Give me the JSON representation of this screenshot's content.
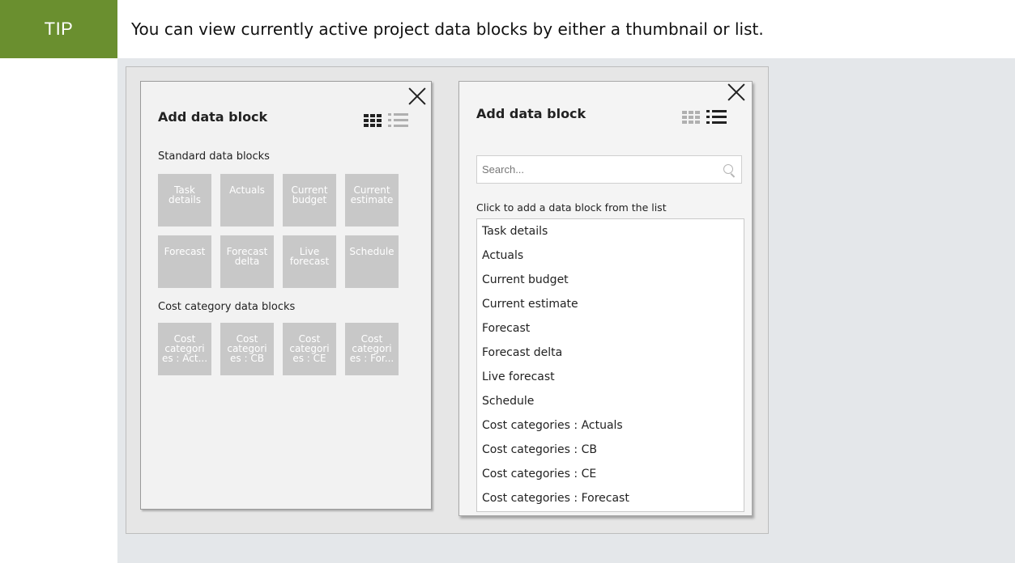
{
  "tip": {
    "badge": "TIP",
    "text": "You can view currently active project data blocks by either a thumbnail or list."
  },
  "thumbnail_panel": {
    "title": "Add data block",
    "standard_label": "Standard data blocks",
    "standard_blocks": [
      "Task\ndetails",
      "Actuals",
      "Current\nbudget",
      "Current\nestimate",
      "Forecast",
      "Forecast\ndelta",
      "Live\nforecast",
      "Schedule"
    ],
    "cost_label": "Cost category data blocks",
    "cost_blocks": [
      "Cost\ncategori\nes : Act...",
      "Cost\ncategori\nes : CB",
      "Cost\ncategori\nes : CE",
      "Cost\ncategori\nes : For..."
    ]
  },
  "list_panel": {
    "title": "Add data block",
    "search_placeholder": "Search...",
    "instructions": "Click to add a data block from the list",
    "items": [
      "Task details",
      "Actuals",
      "Current budget",
      "Current estimate",
      "Forecast",
      "Forecast delta",
      "Live forecast",
      "Schedule",
      "Cost categories : Actuals",
      "Cost categories : CB",
      "Cost categories : CE",
      "Cost categories : Forecast"
    ]
  },
  "colors": {
    "tip_badge": "#6a8f2f",
    "tile": "#c8c8c8",
    "tip_background": "#e4e7ea"
  }
}
